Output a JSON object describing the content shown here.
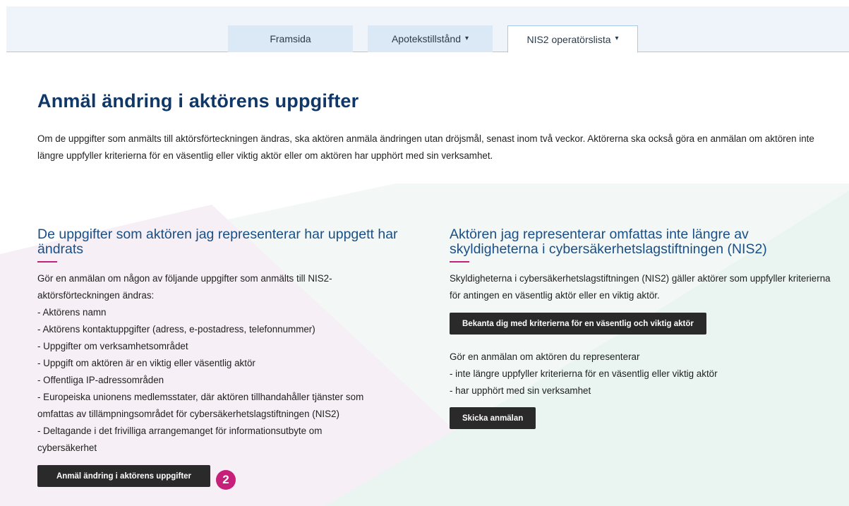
{
  "nav": {
    "tabs": [
      {
        "label": "Framsida",
        "has_dropdown": false,
        "active": false
      },
      {
        "label": "Apotekstillstånd",
        "has_dropdown": true,
        "active": false
      },
      {
        "label": "NIS2 operatörslista",
        "has_dropdown": true,
        "active": true
      }
    ],
    "dropdown_glyph": "▾"
  },
  "main": {
    "title": "Anmäl ändring i aktörens uppgifter",
    "intro": "Om de uppgifter som anmälts till aktörsförteckningen ändras, ska aktören anmäla ändringen utan dröjsmål, senast inom två veckor. Aktörerna ska också göra en anmälan om aktören inte längre uppfyller kriterierna för en väsentlig eller viktig aktör eller om aktören har upphört med sin verksamhet."
  },
  "left": {
    "heading": "De uppgifter som aktören jag representerar har uppgett har ändrats",
    "lines": [
      "Gör en anmälan om någon av följande uppgifter som anmälts till NIS2-",
      "aktörsförteckningen ändras:",
      "- Aktörens namn",
      "- Aktörens kontaktuppgifter (adress, e-postadress, telefonnummer)",
      "- Uppgifter om verksamhetsområdet",
      "- Uppgift om aktören är en viktig eller väsentlig aktör",
      "- Offentliga IP-adressområden",
      "- Europeiska unionens medlemsstater, där aktören tillhandahåller tjänster som",
      "omfattas av tillämpningsområdet för cybersäkerhetslagstiftningen (NIS2)",
      "- Deltagande i det frivilliga arrangemanget för informationsutbyte om",
      "cybersäkerhet"
    ],
    "button": "Anmäl ändring i aktörens uppgifter",
    "badge": "2"
  },
  "right": {
    "heading": "Aktören jag representerar omfattas inte längre av skyldigheterna i cybersäkerhetslagstiftningen (NIS2)",
    "para": "Skyldigheterna i cybersäkerhetslagstiftningen (NIS2) gäller aktörer som uppfyller kriterierna för antingen en väsentlig aktör eller en viktig aktör.",
    "criteria_button": "Bekanta dig med kriterierna för en väsentlig och viktig aktör",
    "lines": [
      "Gör en anmälan om aktören du representerar",
      "- inte längre uppfyller kriterierna för en väsentlig eller viktig aktör",
      "- har upphört med sin verksamhet"
    ],
    "submit_button": "Skicka anmälan"
  },
  "colors": {
    "title": "#0f3768",
    "heading": "#1a4f86",
    "accent": "#c6207a",
    "button_bg": "#2a2a2a",
    "header_bg": "#eef4fa",
    "tab_bg": "#dbe9f6",
    "shape_pink": "#f5eef4",
    "shape_mint": "#eef7f5"
  }
}
